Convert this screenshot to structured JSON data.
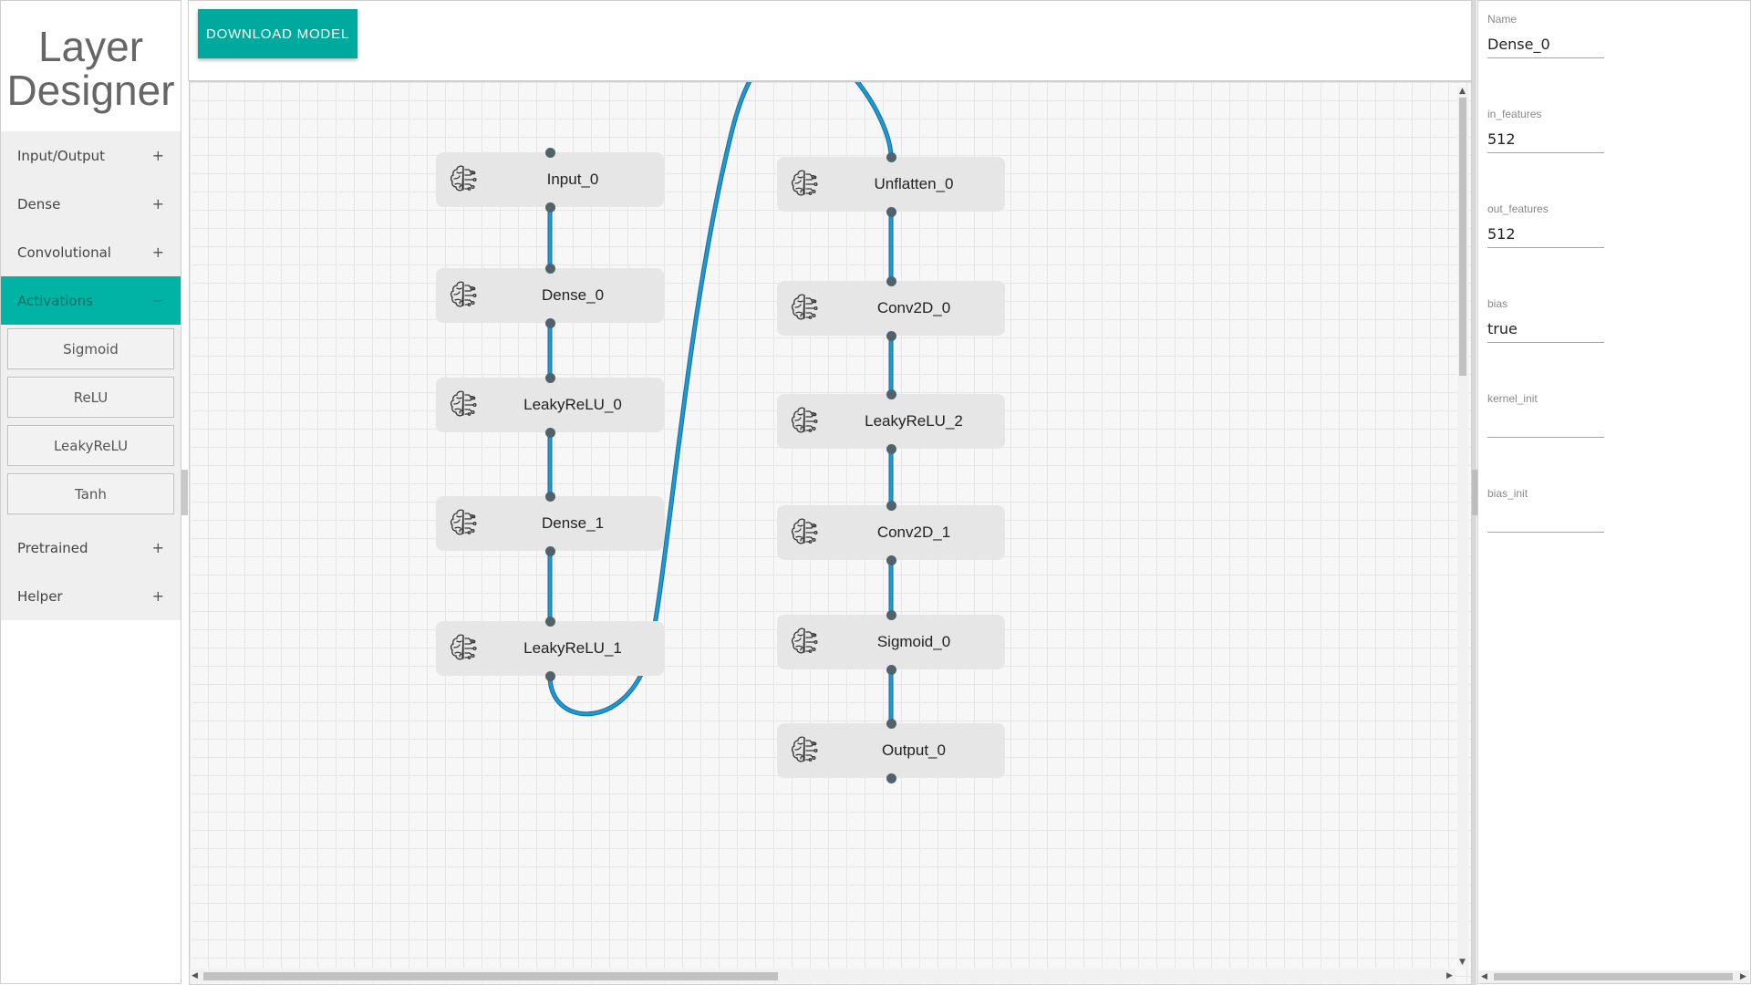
{
  "app": {
    "title_line1": "Layer",
    "title_line2": "Designer"
  },
  "sidebar": {
    "categories": [
      {
        "label": "Input/Output",
        "toggle": "+"
      },
      {
        "label": "Dense",
        "toggle": "+"
      },
      {
        "label": "Convolutional",
        "toggle": "+"
      },
      {
        "label": "Activations",
        "toggle": "−",
        "active": true
      },
      {
        "label": "Pretrained",
        "toggle": "+"
      },
      {
        "label": "Helper",
        "toggle": "+"
      }
    ],
    "activation_items": [
      "Sigmoid",
      "ReLU",
      "LeakyReLU",
      "Tanh"
    ]
  },
  "toolbar": {
    "download_label": "DOWNLOAD MODEL"
  },
  "graph": {
    "nodes": [
      {
        "id": "Input_0",
        "label": "Input_0",
        "icon": "brain-circuit-icon"
      },
      {
        "id": "Dense_0",
        "label": "Dense_0",
        "icon": "brain-circuit-icon"
      },
      {
        "id": "LeakyReLU_0",
        "label": "LeakyReLU_0",
        "icon": "brain-circuit-icon"
      },
      {
        "id": "Dense_1",
        "label": "Dense_1",
        "icon": "brain-circuit-icon"
      },
      {
        "id": "LeakyReLU_1",
        "label": "LeakyReLU_1",
        "icon": "brain-circuit-icon"
      },
      {
        "id": "Unflatten_0",
        "label": "Unflatten_0",
        "icon": "brain-circuit-icon"
      },
      {
        "id": "Conv2D_0",
        "label": "Conv2D_0",
        "icon": "brain-circuit-icon"
      },
      {
        "id": "LeakyReLU_2",
        "label": "LeakyReLU_2",
        "icon": "brain-circuit-icon"
      },
      {
        "id": "Conv2D_1",
        "label": "Conv2D_1",
        "icon": "brain-circuit-icon"
      },
      {
        "id": "Sigmoid_0",
        "label": "Sigmoid_0",
        "icon": "brain-circuit-icon"
      },
      {
        "id": "Output_0",
        "label": "Output_0",
        "icon": "brain-circuit-icon"
      }
    ],
    "edges": [
      [
        "Input_0",
        "Dense_0"
      ],
      [
        "Dense_0",
        "LeakyReLU_0"
      ],
      [
        "LeakyReLU_0",
        "Dense_1"
      ],
      [
        "Dense_1",
        "LeakyReLU_1"
      ],
      [
        "LeakyReLU_1",
        "Unflatten_0"
      ],
      [
        "Unflatten_0",
        "Conv2D_0"
      ],
      [
        "Conv2D_0",
        "LeakyReLU_2"
      ],
      [
        "LeakyReLU_2",
        "Conv2D_1"
      ],
      [
        "Conv2D_1",
        "Sigmoid_0"
      ],
      [
        "Sigmoid_0",
        "Output_0"
      ]
    ],
    "edge_color": "#1a9bd7",
    "port_color": "#50636b"
  },
  "properties": {
    "fields": [
      {
        "key": "name",
        "label": "Name",
        "value": "Dense_0"
      },
      {
        "key": "in_features",
        "label": "in_features",
        "value": "512"
      },
      {
        "key": "out_features",
        "label": "out_features",
        "value": "512"
      },
      {
        "key": "bias",
        "label": "bias",
        "value": "true"
      },
      {
        "key": "kernel_init",
        "label": "kernel_init",
        "value": ""
      },
      {
        "key": "bias_init",
        "label": "bias_init",
        "value": ""
      }
    ]
  },
  "colors": {
    "accent": "#00a99d",
    "active_category": "#00b3a4"
  }
}
